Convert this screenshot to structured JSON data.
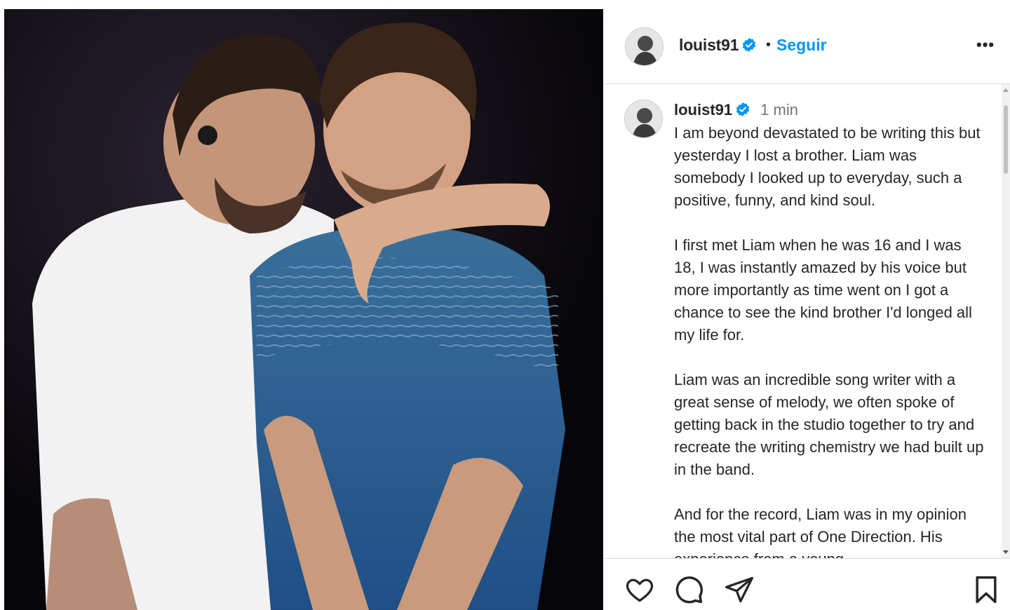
{
  "post": {
    "author": "louist91",
    "verified": true,
    "separator": "•",
    "follow_label": "Seguir",
    "more_label": "•••"
  },
  "caption": {
    "author": "louist91",
    "time": "1 min",
    "paragraphs": [
      "I am beyond devastated to be writing this but yesterday I lost a brother. Liam was somebody I looked up to everyday, such a positive, funny, and kind soul.",
      "I first met Liam when he was 16 and I was 18, I was instantly amazed by his voice but more importantly as time went on I got a chance to see the kind brother I'd longed all my life for.",
      "Liam was an incredible song writer with a great sense of melody, we often spoke of getting back in the studio together to try and recreate the writing chemistry we had built up in the band.",
      "And for the record, Liam was in my opinion the most vital part of One Direction. His experience from a young"
    ]
  },
  "icons": {
    "verified": "verified-badge-icon",
    "like": "heart-icon",
    "comment": "comment-bubble-icon",
    "share": "paper-plane-icon",
    "save": "bookmark-icon"
  },
  "colors": {
    "accent": "#0095f6",
    "text": "#262626",
    "muted": "#737373",
    "border": "#dbdbdb"
  }
}
